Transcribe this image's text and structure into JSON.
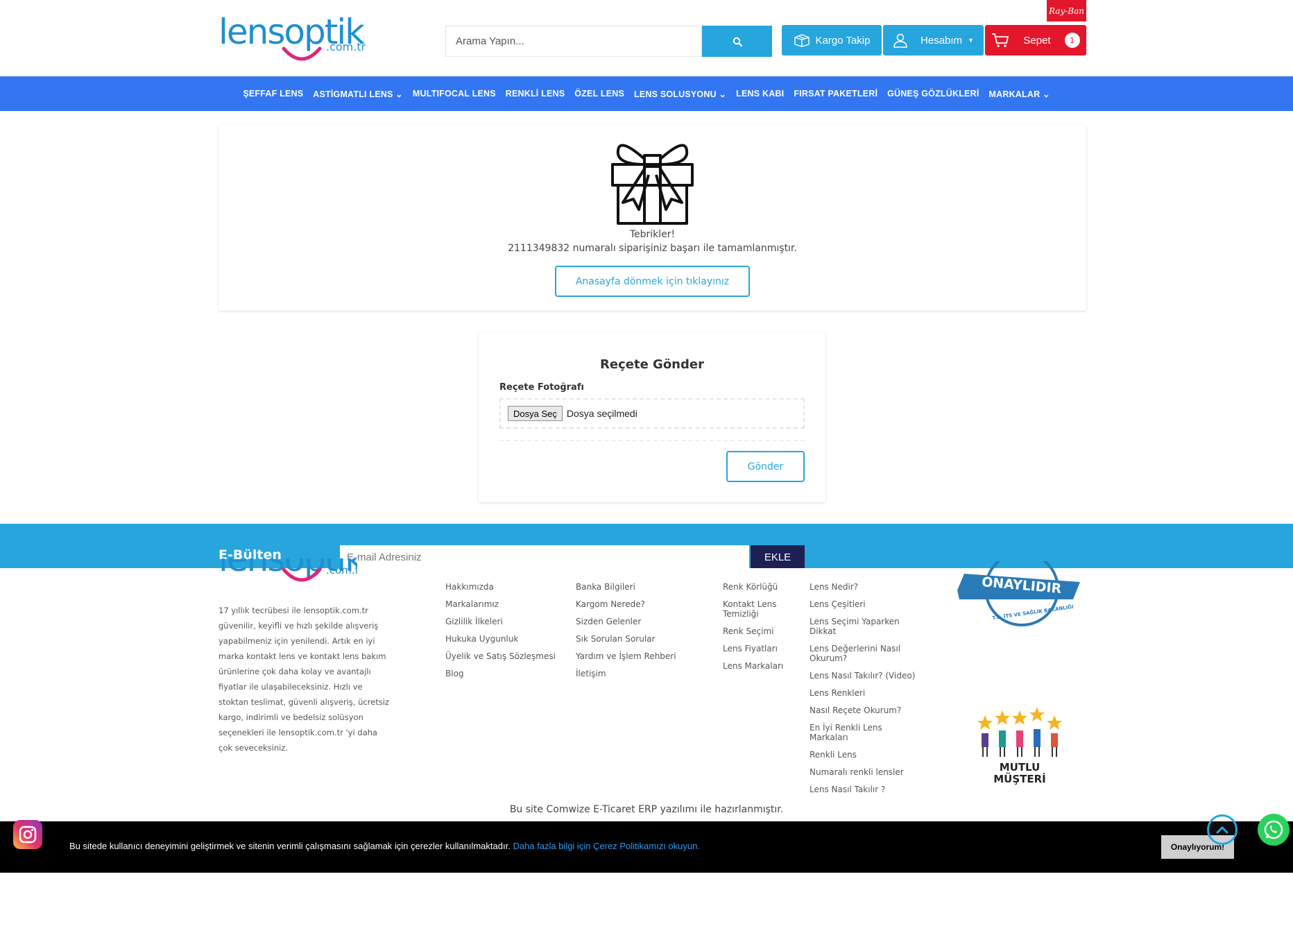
{
  "header": {
    "logo_text": "lensoptik",
    "logo_suffix": ".com.tr",
    "rayban_text": "Ray-Ban",
    "search_placeholder": "Arama Yapın...",
    "kargo_label": "Kargo Takip",
    "hesap_label": "Hesabım",
    "sepet_label": "Sepet",
    "sepet_count": "1",
    "brand_blue": "#27a5dd",
    "brand_red": "#e3172b"
  },
  "nav": {
    "color": "#3376f2",
    "items": [
      "ŞEFFAF LENS",
      "ASTİGMATLI LENS ⌄",
      "MULTIFOCAL LENS",
      "RENKLİ LENS",
      "ÖZEL LENS",
      "LENS SOLUSYONU ⌄",
      "LENS KABI",
      "FIRSAT PAKETLERİ",
      "GÜNEŞ GÖZLÜKLERİ",
      "MARKALAR ⌄"
    ]
  },
  "success": {
    "icon": "gift-icon",
    "title": "Tebrikler!",
    "message": "2111349832 numaralı siparişiniz başarı ile tamamlanmıştır.",
    "home_button": "Anasayfa dönmek için tıklayınız"
  },
  "prescription": {
    "title": "Reçete Gönder",
    "photo_label": "Reçete Fotoğrafı",
    "file_button": "Dosya Seç",
    "file_status": "Dosya seçilmedi",
    "send_button": "Gönder"
  },
  "newsletter": {
    "title": "E-Bülten",
    "placeholder": "E-mail Adresiniz",
    "button": "EKLE"
  },
  "footer": {
    "about": "17 yıllık tecrübesi ile lensoptik.com.tr güvenilir, keyifli ve hızlı şekilde alışveriş yapabilmeniz için yenilendi. Artık en iyi marka kontakt lens ve kontakt lens bakım ürünlerine çok daha kolay ve avantajlı fiyatlar ile ulaşabileceksiniz. Hızlı ve stoktan teslimat, güvenli alışveriş, ücretsiz kargo, indirimli ve bedelsiz solüsyon seçenekleri ile lensoptik.com.tr 'yi daha çok seveceksiniz.",
    "col1": [
      "Hakkımızda",
      "Markalarımız",
      "Gizlilik İlkeleri",
      "Hukuka Uygunluk",
      "Üyelik ve Satış Sözleşmesi",
      "Blog"
    ],
    "col2": [
      "Banka Bilgileri",
      "Kargom Nerede?",
      "Sizden Gelenler",
      "Sık Sorulan Sorular",
      "Yardım ve İşlem Rehberi",
      "İletişim"
    ],
    "col3": [
      "Renk Körlüğü",
      "Kontakt Lens Temizliği",
      "Renk Seçimi",
      "Lens Fiyatları",
      "Lens Markaları"
    ],
    "col4": [
      "Lens Nedir?",
      "Lens Çeşitleri",
      "Lens Seçimi Yaparken Dikkat",
      "Lens Değerlerini Nasıl Okurum?",
      "Lens Nasıl Takılır? (Video)",
      "Lens Renkleri",
      "Nasıl Reçete Okurum?",
      "En İyi Renkli Lens Markaları",
      "Renkli Lens",
      "Numaralı renkli lensler",
      "Lens Nasıl Takılır ?"
    ],
    "onay_badge": "ONAYLIDIR",
    "onay_sub": "T.C. İTS VE SAĞLIK BAKANLIĞI",
    "mutlu_line1": "MUTLU",
    "mutlu_line2": "MÜŞTERİ",
    "credit": "Bu site Comwize E-Ticaret ERP yazılımı ile hazırlanmıştır."
  },
  "cookie": {
    "text": "Bu sitede kullanıcı deneyimini geliştirmek ve sitenin verimli çalışmasını sağlamak için çerezler kullanılmaktadır.",
    "link": "Daha fazla bilgi için Çerez Politikamızı okuyun.",
    "button": "Onaylıyorum!"
  }
}
